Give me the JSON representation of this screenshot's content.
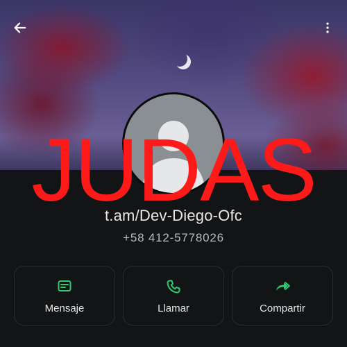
{
  "header": {
    "back_icon": "arrow-left-icon",
    "more_icon": "more-vertical-icon"
  },
  "profile": {
    "avatar_icon": "default-avatar-icon",
    "username": "t.am/Dev-Diego-Ofc",
    "phone": "+58 412-5778026"
  },
  "actions": [
    {
      "label": "Mensaje",
      "icon": "message-icon"
    },
    {
      "label": "Llamar",
      "icon": "phone-icon"
    },
    {
      "label": "Compartir",
      "icon": "share-forward-icon"
    }
  ],
  "overlay": {
    "text": "JUDAS",
    "color": "#ff1a1a"
  },
  "colors": {
    "accent": "#2ecc71",
    "background": "#121416"
  }
}
